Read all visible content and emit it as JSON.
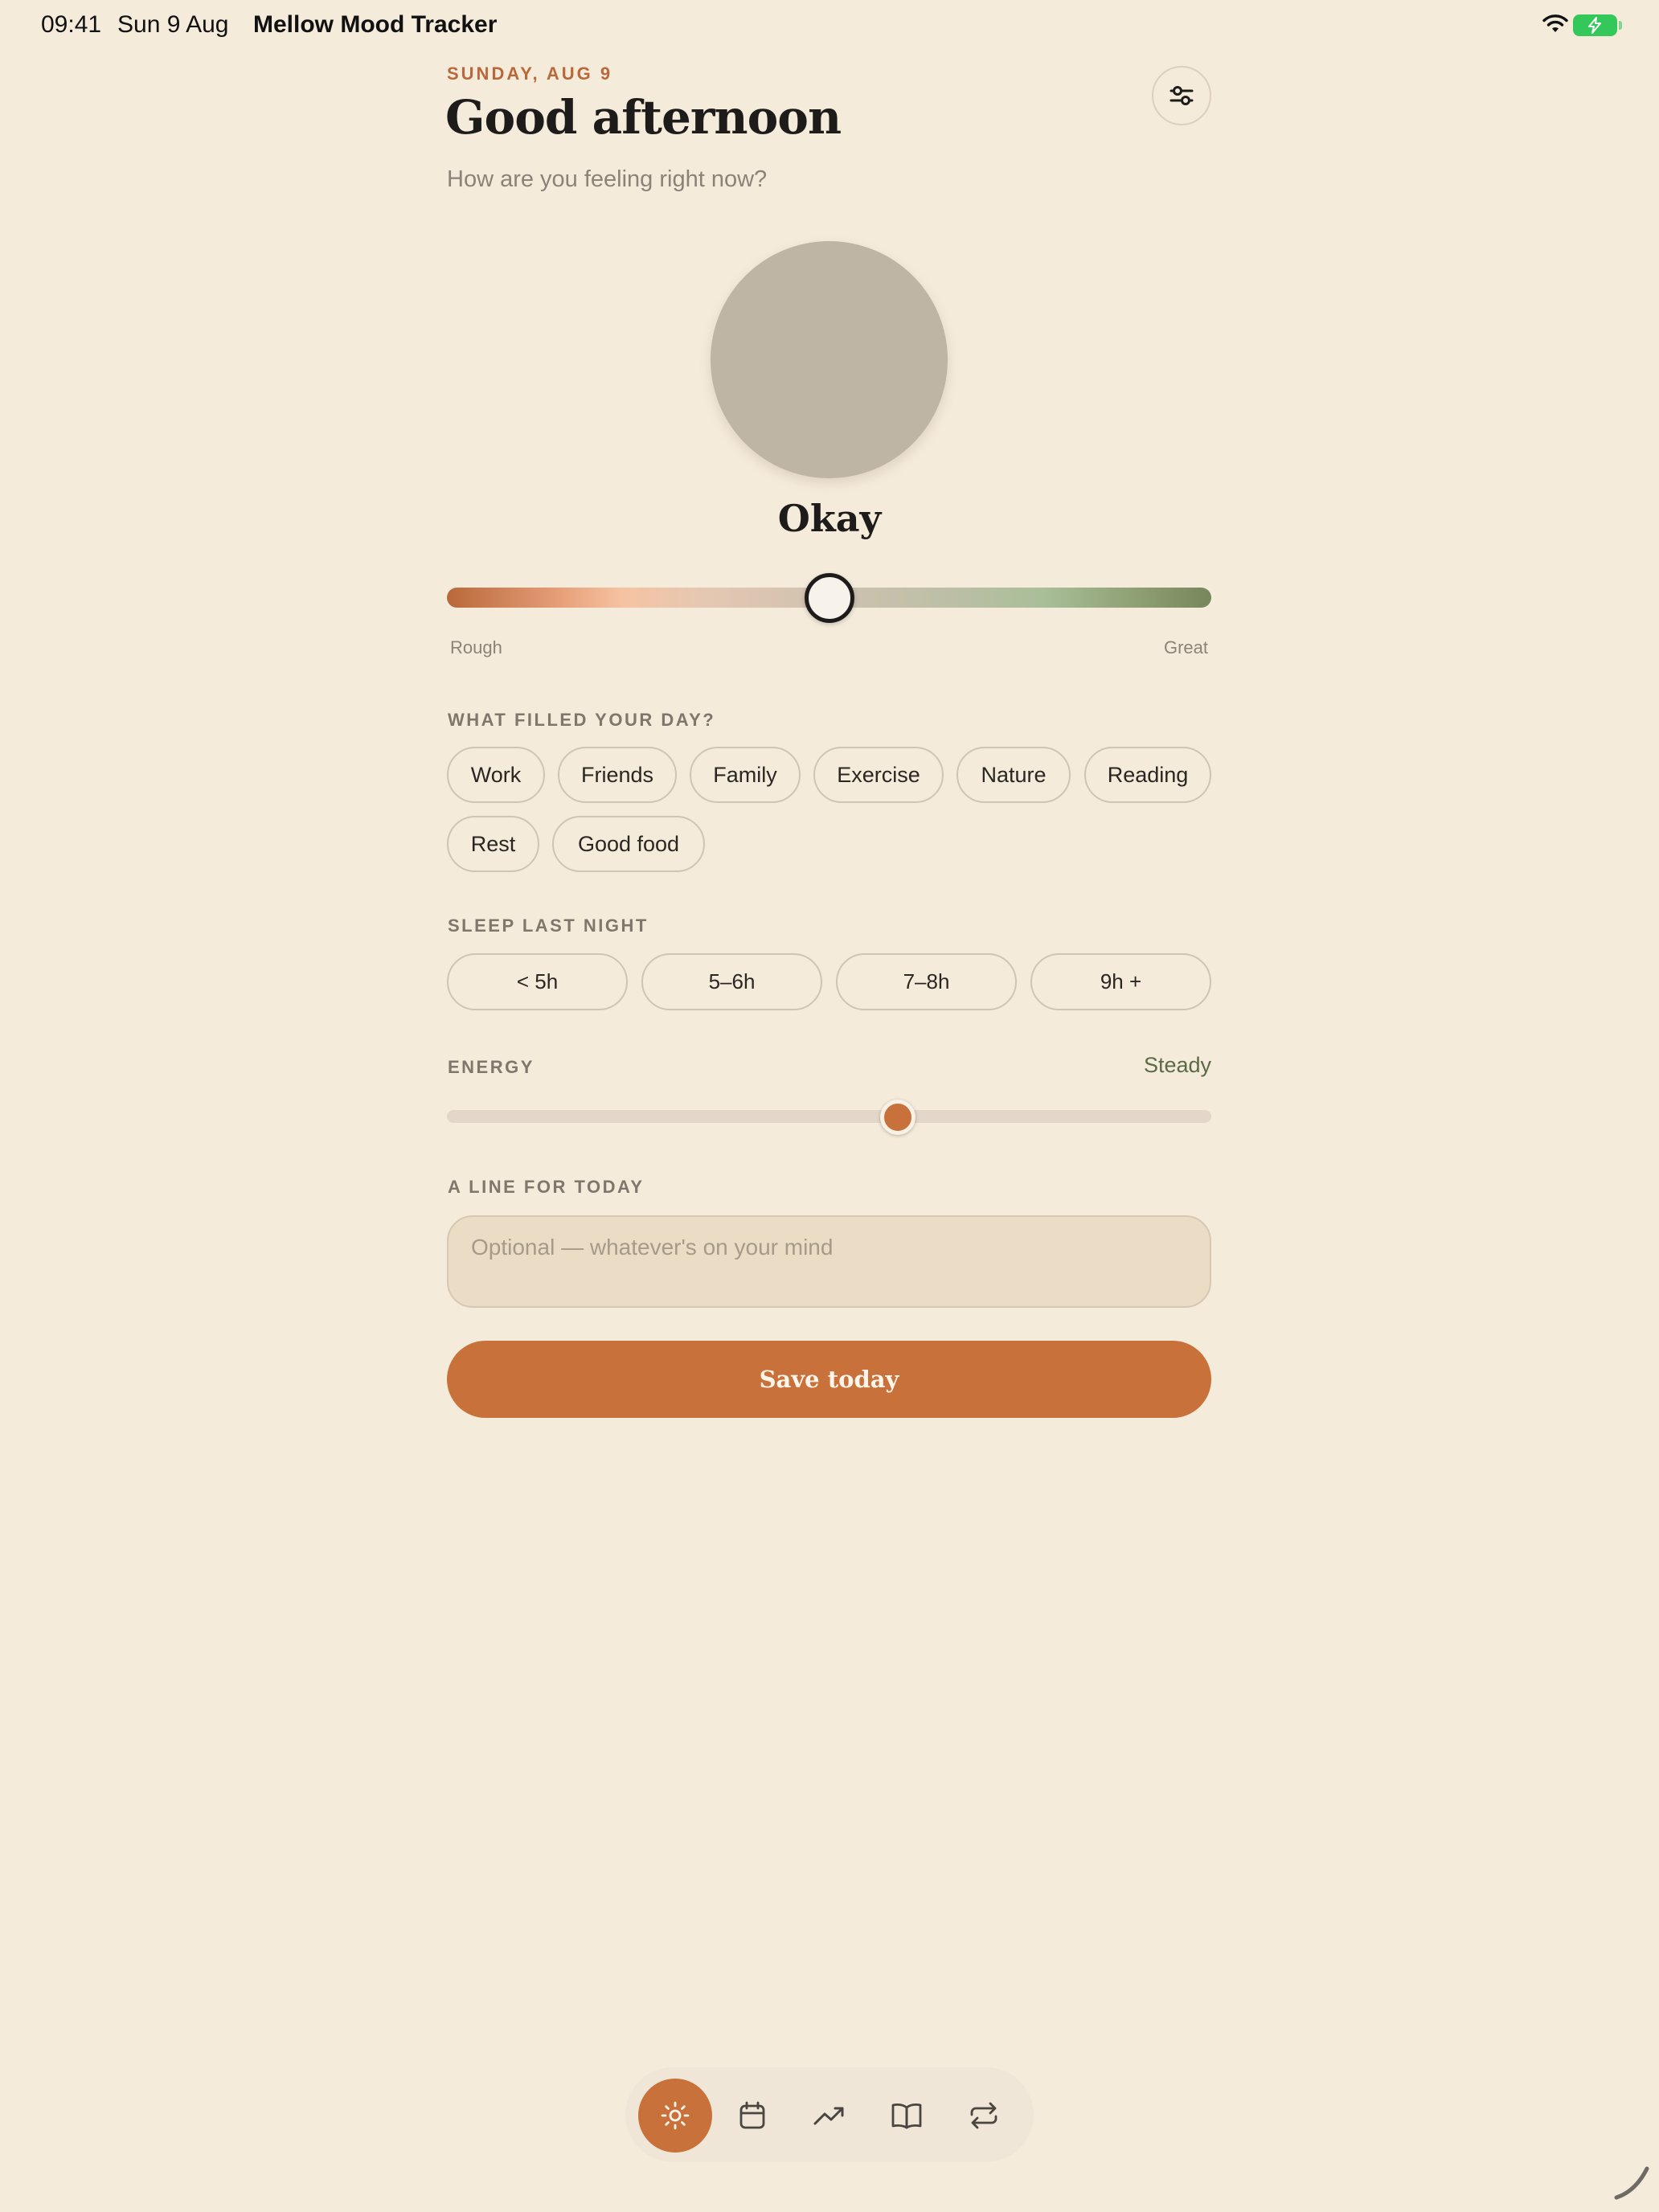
{
  "status_bar": {
    "time": "09:41",
    "date": "Sun 9 Aug",
    "app_name": "Mellow Mood Tracker",
    "battery_color": "#34C759"
  },
  "header": {
    "date_label": "SUNDAY, AUG 9",
    "greeting": "Good afternoon",
    "subtitle": "How are you feeling right now?",
    "settings_icon": "sliders-icon"
  },
  "mood": {
    "label": "Okay",
    "value_fraction": 0.5,
    "orb_color": "#BFB5A5",
    "scale_left": "Rough",
    "scale_right": "Great"
  },
  "activities": {
    "label": "WHAT FILLED YOUR DAY?",
    "chips": [
      "Work",
      "Friends",
      "Family",
      "Exercise",
      "Nature",
      "Reading",
      "Rest",
      "Good food"
    ]
  },
  "sleep": {
    "label": "SLEEP LAST NIGHT",
    "options": [
      "< 5h",
      "5–6h",
      "7–8h",
      "9h +"
    ]
  },
  "energy": {
    "label": "ENERGY",
    "value_label": "Steady",
    "value_fraction": 0.59
  },
  "note": {
    "label": "A LINE FOR TODAY",
    "placeholder": "Optional — whatever's on your mind",
    "value": ""
  },
  "save_button": {
    "label": "Save today",
    "color": "#C8713B"
  },
  "nav": {
    "items": [
      {
        "icon": "sun-icon",
        "active": true
      },
      {
        "icon": "calendar-icon",
        "active": false
      },
      {
        "icon": "trending-up-icon",
        "active": false
      },
      {
        "icon": "book-open-icon",
        "active": false
      },
      {
        "icon": "repeat-icon",
        "active": false
      }
    ]
  },
  "colors": {
    "background": "#F5EBDB",
    "accent": "#C8713B",
    "positive": "#5B6A45"
  }
}
